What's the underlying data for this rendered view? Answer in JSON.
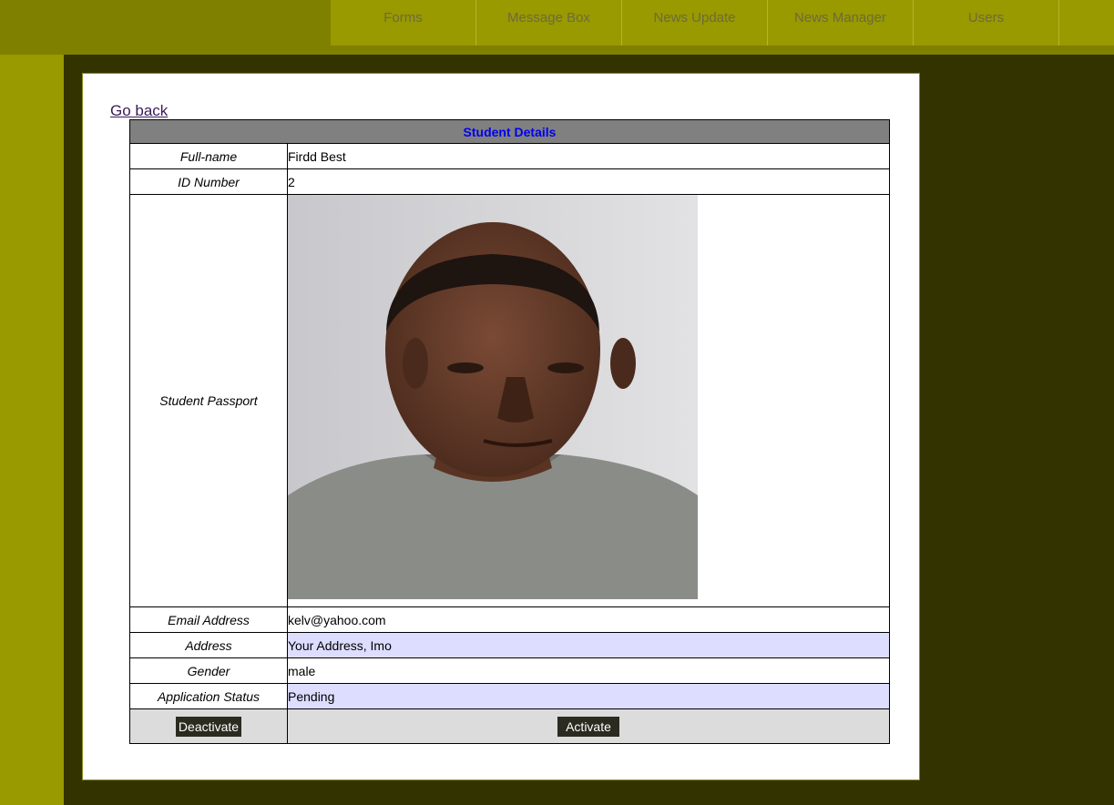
{
  "nav": {
    "items": [
      "Forms",
      "Message Box",
      "News Update",
      "News Manager",
      "Users"
    ]
  },
  "go_back": "Go back",
  "details": {
    "title": "Student Details",
    "rows": {
      "fullname": {
        "label": "Full-name",
        "value": "Firdd Best"
      },
      "id_number": {
        "label": "ID Number",
        "value": "2"
      },
      "passport": {
        "label": "Student Passport"
      },
      "email": {
        "label": "Email Address",
        "value": "kelv@yahoo.com"
      },
      "address": {
        "label": "Address",
        "value": "Your Address, Imo"
      },
      "gender": {
        "label": "Gender",
        "value": "male"
      },
      "status": {
        "label": "Application Status",
        "value": "Pending"
      }
    },
    "buttons": {
      "deactivate": "Deactivate",
      "activate": "Activate"
    }
  },
  "colors": {
    "background": "#333300",
    "olive": "#808000",
    "nav": "#999900",
    "highlight_row": "#ddddff",
    "header": "#808080"
  }
}
